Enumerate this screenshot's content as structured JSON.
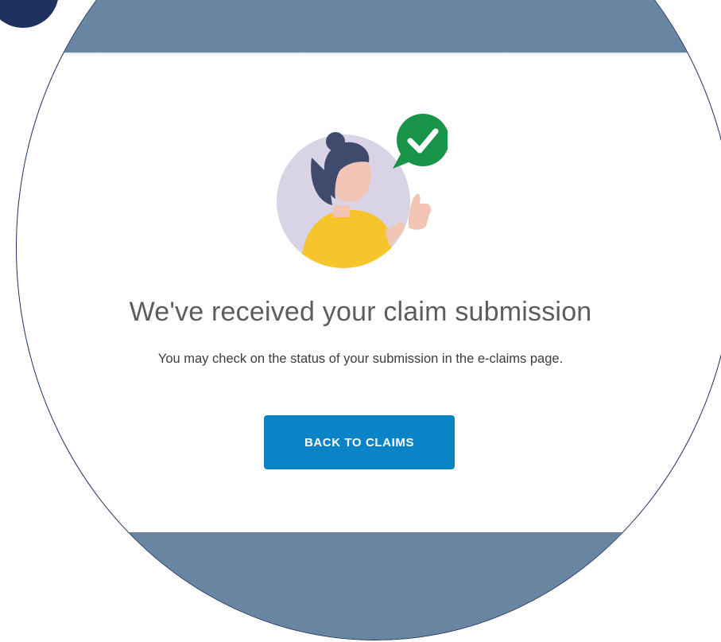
{
  "confirmation": {
    "title": "We've received your claim submission",
    "message": "You may check on the status of your submission in the e-claims page.",
    "button_label": "BACK TO CLAIMS"
  },
  "icons": {
    "illustration": "person-thumbs-up-illustration",
    "badge": "check-icon",
    "corner": "decorative-circle"
  },
  "colors": {
    "band": "#6885a1",
    "accent_button": "#0a84c6",
    "success_badge": "#179447",
    "lens_border": "#1e3161",
    "illustration_bg": "#d9d4e5",
    "shirt": "#f6c42b"
  }
}
